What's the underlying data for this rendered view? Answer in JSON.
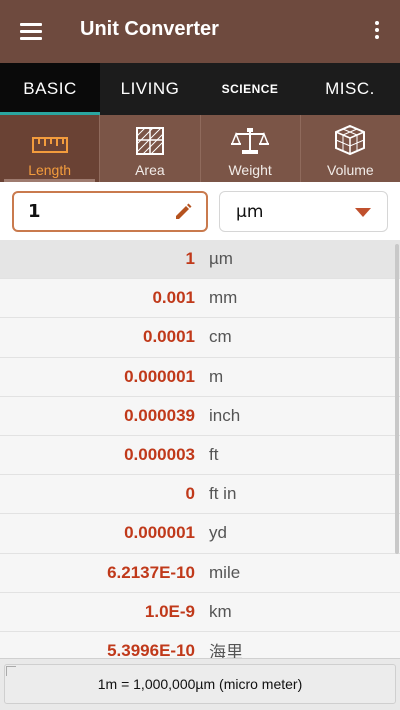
{
  "app": {
    "title": "Unit Converter"
  },
  "tabs": [
    {
      "label": "BASIC",
      "active": true
    },
    {
      "label": "LIVING",
      "active": false
    },
    {
      "label": "SCIENCE",
      "active": false
    },
    {
      "label": "MISC.",
      "active": false
    }
  ],
  "categories": [
    {
      "label": "Length",
      "icon": "ruler-icon",
      "active": true
    },
    {
      "label": "Area",
      "icon": "area-grid-icon",
      "active": false
    },
    {
      "label": "Weight",
      "icon": "scale-icon",
      "active": false
    },
    {
      "label": "Volume",
      "icon": "cube-icon",
      "active": false
    }
  ],
  "input": {
    "value": "1",
    "unit": "µm"
  },
  "results": [
    {
      "value": "1",
      "unit": "µm"
    },
    {
      "value": "0.001",
      "unit": "mm"
    },
    {
      "value": "0.0001",
      "unit": "cm"
    },
    {
      "value": "0.000001",
      "unit": "m"
    },
    {
      "value": "0.000039",
      "unit": "inch"
    },
    {
      "value": "0.000003",
      "unit": "ft"
    },
    {
      "value": "0",
      "unit": "ft in"
    },
    {
      "value": "0.000001",
      "unit": "yd"
    },
    {
      "value": "6.2137E-10",
      "unit": "mile"
    },
    {
      "value": "1.0E-9",
      "unit": "km"
    },
    {
      "value": "5.3996E-10",
      "unit": "海里"
    }
  ],
  "footer": {
    "text": "1m = 1,000,000µm (micro meter)"
  },
  "colors": {
    "appbar": "#6e4a3e",
    "accent": "#f39c3d",
    "value_red": "#c0391a",
    "tab_indicator": "#2aa6a0"
  }
}
